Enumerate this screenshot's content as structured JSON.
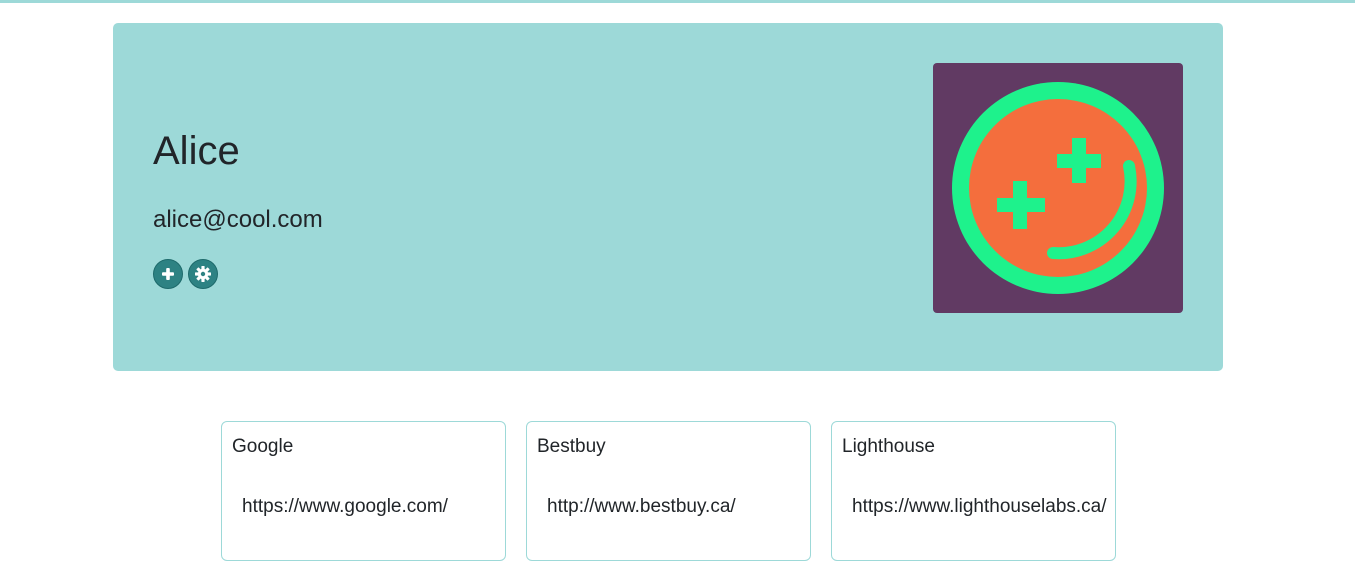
{
  "profile": {
    "name": "Alice",
    "email": "alice@cool.com",
    "avatar_icon": "smiley-plus-icon"
  },
  "actions": [
    {
      "icon": "plus-circle-icon"
    },
    {
      "icon": "gear-icon"
    }
  ],
  "urls": [
    {
      "title": "Google",
      "url": "https://www.google.com/"
    },
    {
      "title": "Bestbuy",
      "url": "http://www.bestbuy.ca/"
    },
    {
      "title": "Lighthouse",
      "url": "https://www.lighthouselabs.ca/"
    }
  ],
  "colors": {
    "accent": "#9dd9d8",
    "button": "#2d8283",
    "avatar_bg": "#613a63",
    "avatar_ring": "#1ef28c",
    "avatar_face": "#f46e3d"
  }
}
